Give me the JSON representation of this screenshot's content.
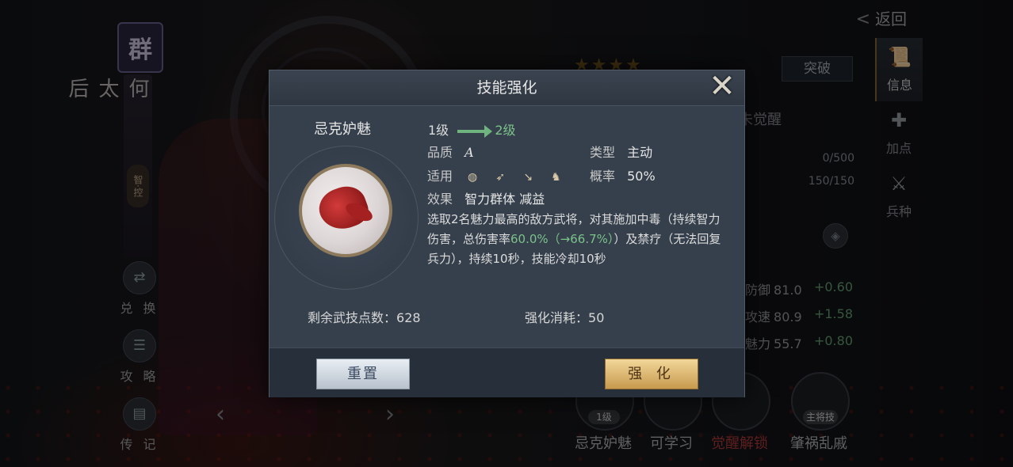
{
  "hero": {
    "faction": "群",
    "name": "何太后",
    "role": "智·控"
  },
  "side_menu": [
    {
      "label": "兑 换",
      "icon": "exchange-icon"
    },
    {
      "label": "攻 略",
      "icon": "guide-icon"
    },
    {
      "label": "传 记",
      "icon": "biography-icon"
    }
  ],
  "top": {
    "back_label": "返回",
    "stars": "★★★★",
    "breakthrough_label": "突破",
    "awaken_status": "未觉醒"
  },
  "bars": {
    "exp": "0/500",
    "troops": "150/150"
  },
  "stats": [
    {
      "name": "防御",
      "value": "81.0",
      "inc": "+0.60"
    },
    {
      "name": "攻速",
      "value": "80.9",
      "inc": "+1.58"
    },
    {
      "name": "魅力",
      "value": "55.7",
      "inc": "+0.80"
    }
  ],
  "tabs": [
    {
      "label": "信息",
      "icon": "scroll-icon"
    },
    {
      "label": "加点",
      "icon": "points-icon"
    },
    {
      "label": "兵种",
      "icon": "troop-icon"
    }
  ],
  "skill_slots": [
    {
      "label": "忌克妒魅",
      "tag": "1级"
    },
    {
      "label": "可学习",
      "tag": ""
    },
    {
      "label": "觉醒解锁",
      "tag": ""
    },
    {
      "label": "肇祸乱戚",
      "tag": "主将技"
    }
  ],
  "dialog": {
    "title": "技能强化",
    "skill_name": "忌克妒魅",
    "level_from": "1级",
    "level_to": "2级",
    "quality_label": "品质",
    "quality_value": "A",
    "type_label": "类型",
    "type_value": "主动",
    "applies_label": "适用",
    "applies_icons": [
      "shield-unit-icon",
      "bow-unit-icon",
      "spear-unit-icon",
      "horse-unit-icon"
    ],
    "chance_label": "概率",
    "chance_value": "50%",
    "effect_label": "效果",
    "effect_value": "智力群体 减益",
    "desc_part1": "选取2名魅力最高的敌方武将，对其施加中毒（持续智力伤害，总伤害率",
    "desc_highlight": "60.0%（→66.7%）",
    "desc_part2": "）及禁疗（无法回复兵力），持续10秒，技能冷却10秒",
    "points_label": "剩余武技点数：",
    "points_value": "628",
    "cost_label": "强化消耗：",
    "cost_value": "50",
    "reset_label": "重置",
    "enhance_label": "强 化"
  },
  "colors": {
    "highlight_green": "#7ac28a",
    "gold_button": "#c79a4e",
    "dialog_bg": "#36404c"
  }
}
